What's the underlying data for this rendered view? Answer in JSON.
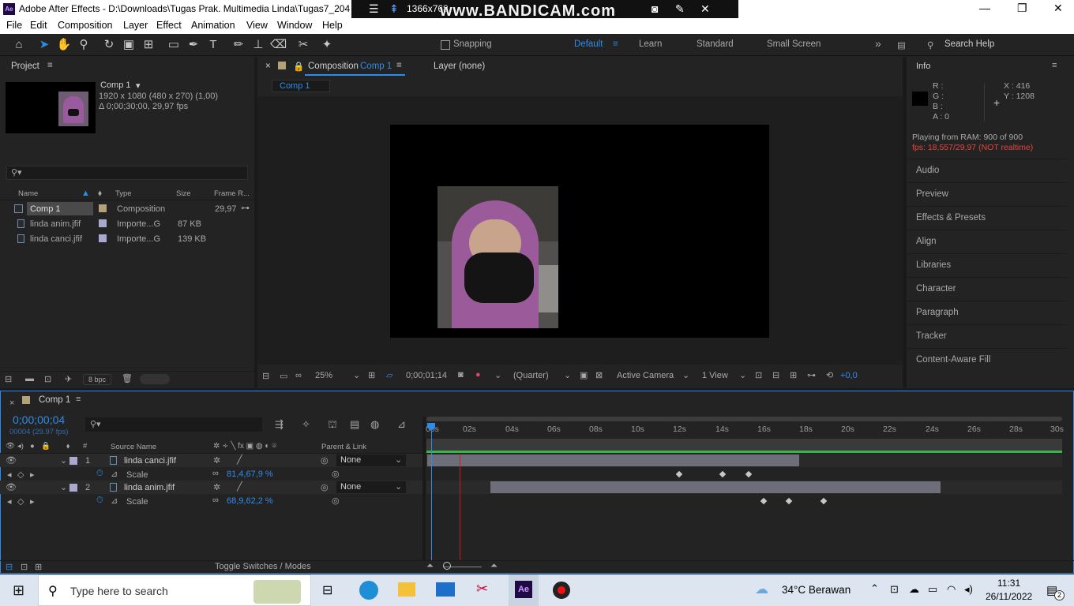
{
  "window": {
    "app_badge": "Ae",
    "title": "Adobe After Effects - D:\\Downloads\\Tugas Prak. Multimedia Linda\\Tugas7_2041"
  },
  "recorder": {
    "resolution": "1366x768",
    "watermark": "www.BANDICAM.com"
  },
  "menu": [
    "File",
    "Edit",
    "Composition",
    "Layer",
    "Effect",
    "Animation",
    "View",
    "Window",
    "Help"
  ],
  "toolbar": {
    "snapping": "Snapping",
    "workspaces": [
      "Default",
      "Learn",
      "Standard",
      "Small Screen"
    ],
    "search": "Search Help"
  },
  "project": {
    "header": "Project",
    "comp_name": "Comp 1",
    "comp_info1": "1920 x 1080  (480 x 270) (1,00)",
    "comp_info2": "Δ 0;00;30;00, 29,97 fps",
    "columns": [
      "Name",
      "Type",
      "Size",
      "Frame R..."
    ],
    "items": [
      {
        "name": "Comp 1",
        "type": "Composition",
        "size": "",
        "fps": "29,97",
        "color": "#b3a17a"
      },
      {
        "name": "linda anim.jfif",
        "type": "Importe...G",
        "size": "87 KB",
        "fps": "",
        "color": "#a9a9d0"
      },
      {
        "name": "linda canci.jfif",
        "type": "Importe...G",
        "size": "139 KB",
        "fps": "",
        "color": "#a9a9d0"
      }
    ],
    "bpc": "8 bpc"
  },
  "viewer": {
    "tab": "Composition",
    "tab_comp": "Comp 1",
    "layer_tab": "Layer (none)",
    "breadcrumb": "Comp 1",
    "zoom": "25%",
    "timecode": "0;00;01;14",
    "resolution": "(Quarter)",
    "camera": "Active Camera",
    "views": "1 View",
    "exposure": "+0,0"
  },
  "info": {
    "header": "Info",
    "r": "R :",
    "g": "G :",
    "b": "B :",
    "a": "A :  0",
    "x": "X : 416",
    "y": "Y : 1208",
    "playing": "Playing from RAM: 900 of 900",
    "fps": "fps: 18,557/29,97 (NOT realtime)",
    "panels": [
      "Audio",
      "Preview",
      "Effects & Presets",
      "Align",
      "Libraries",
      "Character",
      "Paragraph",
      "Tracker",
      "Content-Aware Fill"
    ]
  },
  "timeline": {
    "comp": "Comp 1",
    "timecode": "0;00;00;04",
    "frames": "00004 (29.97 fps)",
    "col_source": "Source Name",
    "col_parent": "Parent & Link",
    "ticks": [
      "00s",
      "02s",
      "04s",
      "06s",
      "08s",
      "10s",
      "12s",
      "14s",
      "16s",
      "18s",
      "20s",
      "22s",
      "24s",
      "26s",
      "28s",
      "30s"
    ],
    "layers": [
      {
        "num": "1",
        "name": "linda canci.jfif",
        "parent": "None",
        "prop": "Scale",
        "value": "81,4,67,9 %"
      },
      {
        "num": "2",
        "name": "linda anim.jfif",
        "parent": "None",
        "prop": "Scale",
        "value": "68,9,62,2 %"
      }
    ],
    "footer": "Toggle Switches / Modes"
  },
  "taskbar": {
    "search": "Type here to search",
    "weather": "34°C  Berawan",
    "time": "11:31",
    "date": "26/11/2022",
    "notif": "2"
  }
}
